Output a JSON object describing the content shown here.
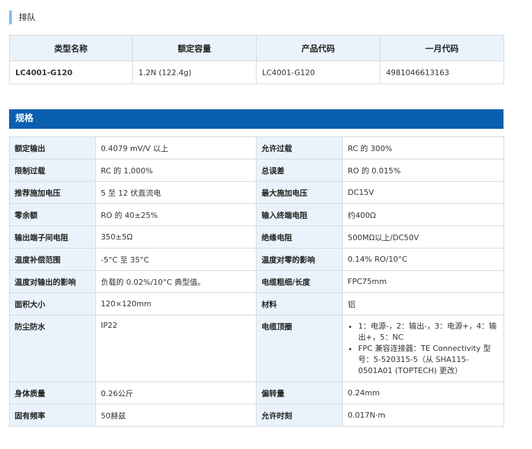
{
  "lineup": {
    "title": "排队",
    "headers": [
      "类型名称",
      "额定容量",
      "产品代码",
      "一月代码"
    ],
    "row": [
      "LC4001-G120",
      "1.2N (122.4g)",
      "LC4001-G120",
      "4981046613163"
    ]
  },
  "specs": {
    "title": "规格",
    "rows": [
      [
        "额定输出",
        "0.4079 mV/V 以上",
        "允许过载",
        "RC 的 300%"
      ],
      [
        "限制过载",
        "RC 的 1,000%",
        "总误差",
        "RO 的 0.015%"
      ],
      [
        "推荐施加电压",
        "5 至 12 伏直流电",
        "最大施加电压",
        "DC15V"
      ],
      [
        "零余额",
        "RO 的 40±25%",
        "输入终端电阻",
        "约400Ω"
      ],
      [
        "输出端子间电阻",
        "350±5Ω",
        "绝缘电阻",
        "500MΩ以上/DC50V"
      ],
      [
        "温度补偿范围",
        "-5°C 至 35°C",
        "温度对零的影响",
        "0.14% RO/10°C"
      ],
      [
        "温度对输出的影响",
        "负载的 0.02%/10°C 典型值。",
        "电缆粗细/长度",
        "FPC75mm"
      ],
      [
        "面积大小",
        "120×120mm",
        "材料",
        "铝"
      ],
      [
        "防尘防水",
        "IP22",
        "电缆顶圈",
        ""
      ],
      [
        "身体质量",
        "0.26公斤",
        "偏转量",
        "0.24mm"
      ],
      [
        "固有频率",
        "50赫兹",
        "允许时刻",
        "0.017N·m"
      ]
    ],
    "cable_list": [
      "1：电源-，2：输出-，3：电源+，4：输出+，5：NC",
      "FPC 兼容连接器：TE Connectivity 型号：5-520315-5（从 SHA115-0501A01 (TOPTECH) 更改）"
    ]
  }
}
